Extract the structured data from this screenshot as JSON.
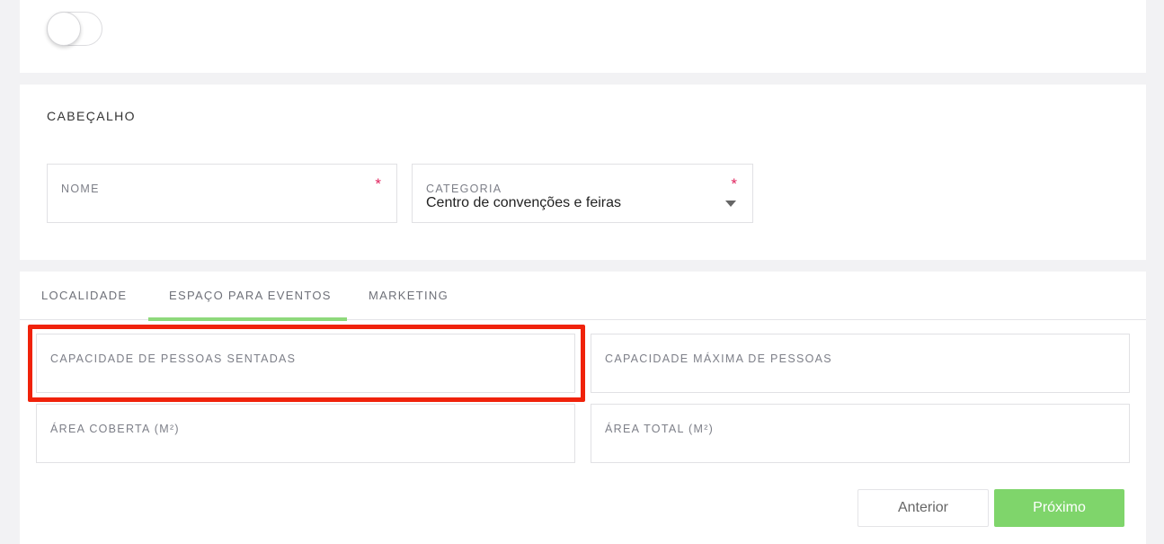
{
  "header": {
    "title": "CABEÇALHO",
    "fields": {
      "nome": {
        "label": "NOME",
        "required": "*",
        "value": ""
      },
      "categoria": {
        "label": "CATEGORIA",
        "required": "*",
        "value": "Centro de convenções e feiras"
      }
    }
  },
  "tabs": {
    "items": [
      {
        "label": "LOCALIDADE"
      },
      {
        "label": "ESPAÇO PARA EVENTOS"
      },
      {
        "label": "MARKETING"
      }
    ],
    "active_index": 1,
    "accent_color": "#8ed97b"
  },
  "event_space": {
    "seated_capacity": {
      "label": "CAPACIDADE DE PESSOAS SENTADAS",
      "value": ""
    },
    "max_capacity": {
      "label": "CAPACIDADE MÁXIMA DE PESSOAS",
      "value": ""
    },
    "covered_area": {
      "label": "ÁREA COBERTA (M²)",
      "value": ""
    },
    "total_area": {
      "label": "ÁREA TOTAL (M²)",
      "value": ""
    }
  },
  "actions": {
    "previous_label": "Anterior",
    "next_label": "Próximo",
    "next_color": "#7fd56b"
  },
  "annotation": {
    "highlight_color": "#f0220a"
  }
}
